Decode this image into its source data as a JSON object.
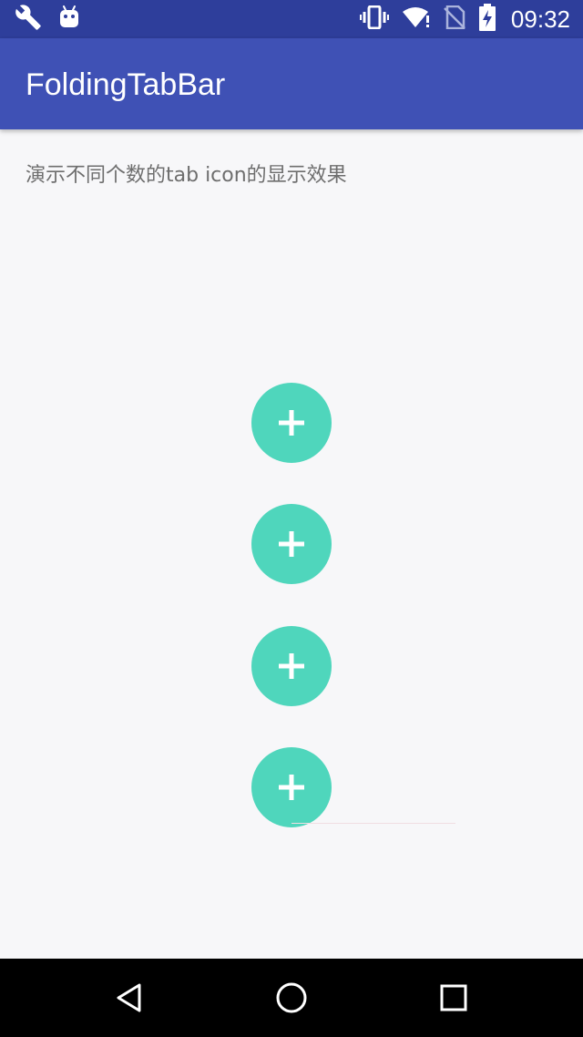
{
  "status_bar": {
    "time": "09:32",
    "icons": [
      "wrench-icon",
      "android-icon",
      "vibrate-icon",
      "wifi-icon",
      "no-sim-icon",
      "battery-charging-icon"
    ]
  },
  "app_bar": {
    "title": "FoldingTabBar",
    "color": "#3f51b5"
  },
  "content": {
    "description": "演示不同个数的tab icon的显示效果",
    "fab_buttons": [
      {
        "icon": "plus-icon",
        "color": "#4fd6bc"
      },
      {
        "icon": "plus-icon",
        "color": "#4fd6bc"
      },
      {
        "icon": "plus-icon",
        "color": "#4fd6bc"
      },
      {
        "icon": "plus-icon",
        "color": "#4fd6bc"
      }
    ]
  },
  "nav_bar": {
    "buttons": [
      "back-icon",
      "home-icon",
      "recents-icon"
    ]
  }
}
